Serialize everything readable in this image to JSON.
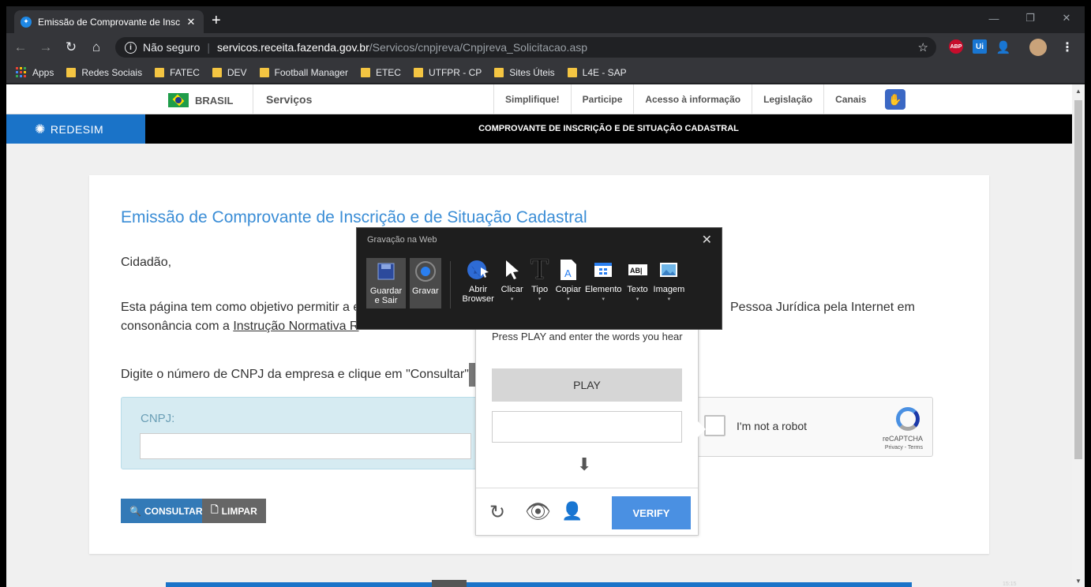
{
  "browser": {
    "tab_title": "Emissão de Comprovante de Insc",
    "tab_close": "✕",
    "new_tab": "+",
    "url_security": "Não seguro",
    "url_host": "servicos.receita.fazenda.gov.br",
    "url_path": "/Servicos/cnpjreva/Cnpjreva_Solicitacao.asp",
    "ext_abp": "ABP",
    "ext_ui": "Ui"
  },
  "bookmarks": [
    {
      "label": "Apps"
    },
    {
      "label": "Redes Sociais"
    },
    {
      "label": "FATEC"
    },
    {
      "label": "DEV"
    },
    {
      "label": "Football Manager"
    },
    {
      "label": "ETEC"
    },
    {
      "label": "UTFPR - CP"
    },
    {
      "label": "Sites Úteis"
    },
    {
      "label": "L4E - SAP"
    }
  ],
  "govbar": {
    "brasil": "BRASIL",
    "servicos": "Serviços",
    "links": [
      "Simplifique!",
      "Participe",
      "Acesso à informação",
      "Legislação",
      "Canais"
    ]
  },
  "titlebar": {
    "brand": "REDESIM",
    "title": "COMPROVANTE DE INSCRIÇÃO E DE SITUAÇÃO CADASTRAL"
  },
  "page": {
    "heading": "Emissão de Comprovante de Inscrição e de Situação Cadastral",
    "greeting": "Cidadão,",
    "para1_start": "Esta página tem como objetivo permitir a e",
    "para1_end": "Pessoa Jurídica pela Internet em",
    "para2_start": "consonância com a ",
    "para2_link": "Instrução Normativa R",
    "instruction": "Digite o número de CNPJ da empresa e clique em \"Consultar\".",
    "cnpj_label": "CNPJ:",
    "consultar": "CONSULTAR",
    "limpar": "LIMPAR"
  },
  "recaptcha": {
    "label": "I'm not a robot",
    "brand": "reCAPTCHA",
    "terms": "Privacy - Terms",
    "instructions": "Press PLAY and enter the words you hear",
    "play": "PLAY",
    "verify": "VERIFY"
  },
  "recorder": {
    "title": "Gravação na Web",
    "tools": [
      {
        "label": "Guardar e Sair"
      },
      {
        "label": "Gravar"
      },
      {
        "label": "Abrir Browser"
      },
      {
        "label": "Clicar"
      },
      {
        "label": "Tipo"
      },
      {
        "label": "Copiar"
      },
      {
        "label": "Elemento"
      },
      {
        "label": "Texto"
      },
      {
        "label": "Imagem"
      }
    ]
  },
  "system": {
    "clock": "15:15"
  },
  "colors": {
    "accent": "#3a8dd6",
    "redesim_blue": "#1a73c8",
    "verify_blue": "#4a90e2"
  }
}
